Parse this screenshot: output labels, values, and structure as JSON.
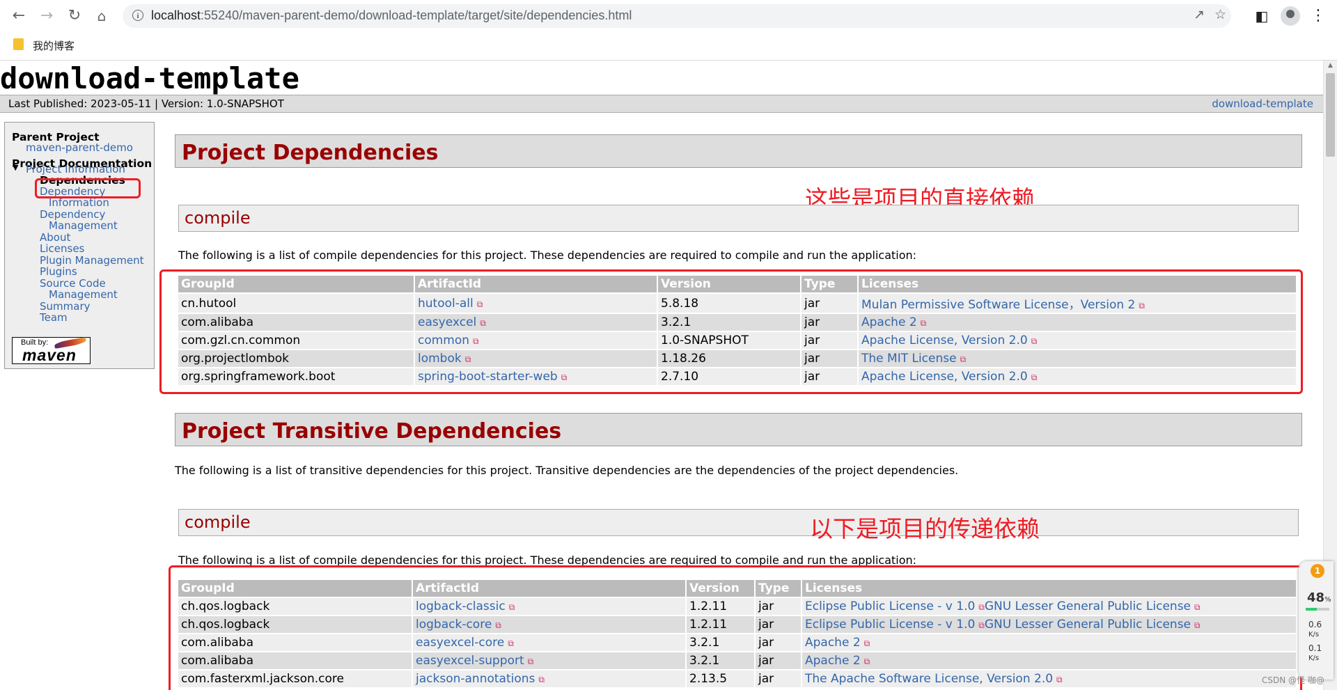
{
  "browser": {
    "back_icon": "arrow-left",
    "forward_icon": "arrow-right",
    "reload_icon": "reload",
    "home_icon": "home",
    "url_host": "localhost",
    "url_path": ":55240/maven-parent-demo/download-template/target/site/dependencies.html",
    "share_icon": "share",
    "star_icon": "star",
    "sidepanel_icon": "side-panel",
    "menu_icon": "more-vertical",
    "bookmark_label": "我的博客"
  },
  "site": {
    "title": "download-template",
    "last_published": "Last Published: 2023-05-11  | Version: 1.0-SNAPSHOT",
    "breadcrumb_right": "download-template"
  },
  "sidebar": {
    "parent_heading": "Parent Project",
    "parent_link": "maven-parent-demo",
    "doc_heading": "Project Documentation",
    "project_info": "Project Information",
    "current": "Dependencies",
    "links": [
      "Dependency",
      "Information",
      "Dependency",
      "Management",
      "About",
      "Licenses",
      "Plugin Management",
      "Plugins",
      "Source Code",
      "Management",
      "Summary",
      "Team"
    ],
    "built_by": "Built by:",
    "maven": "maven"
  },
  "main": {
    "h2_direct": "Project Dependencies",
    "h3_compile": "compile",
    "direct_desc": "The following is a list of compile dependencies for this project. These dependencies are required to compile and run the application:",
    "annot_direct": "这些是项目的直接依赖",
    "columns": [
      "GroupId",
      "ArtifactId",
      "Version",
      "Type",
      "Licenses"
    ],
    "direct_rows": [
      {
        "group": "cn.hutool",
        "artifact": "hutool-all",
        "version": "5.8.18",
        "type": "jar",
        "license": "Mulan Permissive Software License，Version 2"
      },
      {
        "group": "com.alibaba",
        "artifact": "easyexcel",
        "version": "3.2.1",
        "type": "jar",
        "license": "Apache 2"
      },
      {
        "group": "com.gzl.cn.common",
        "artifact": "common",
        "version": "1.0-SNAPSHOT",
        "type": "jar",
        "license": "Apache License, Version 2.0"
      },
      {
        "group": "org.projectlombok",
        "artifact": "lombok",
        "version": "1.18.26",
        "type": "jar",
        "license": "The MIT License"
      },
      {
        "group": "org.springframework.boot",
        "artifact": "spring-boot-starter-web",
        "version": "2.7.10",
        "type": "jar",
        "license": "Apache License, Version 2.0"
      }
    ],
    "h2_transitive": "Project Transitive Dependencies",
    "transitive_desc": "The following is a list of transitive dependencies for this project. Transitive dependencies are the dependencies of the project dependencies.",
    "h3_compile2": "compile",
    "annot_transitive": "以下是项目的传递依赖",
    "transitive_compile_desc": "The following is a list of compile dependencies for this project. These dependencies are required to compile and run the application:",
    "transitive_rows": [
      {
        "group": "ch.qos.logback",
        "artifact": "logback-classic",
        "version": "1.2.11",
        "type": "jar",
        "license": "Eclipse Public License - v 1.0",
        "license2": "GNU Lesser General Public License"
      },
      {
        "group": "ch.qos.logback",
        "artifact": "logback-core",
        "version": "1.2.11",
        "type": "jar",
        "license": "Eclipse Public License - v 1.0",
        "license2": "GNU Lesser General Public License"
      },
      {
        "group": "com.alibaba",
        "artifact": "easyexcel-core",
        "version": "3.2.1",
        "type": "jar",
        "license": "Apache 2",
        "license2": ""
      },
      {
        "group": "com.alibaba",
        "artifact": "easyexcel-support",
        "version": "3.2.1",
        "type": "jar",
        "license": "Apache 2",
        "license2": ""
      },
      {
        "group": "com.fasterxml.jackson.core",
        "artifact": "jackson-annotations",
        "version": "2.13.5",
        "type": "jar",
        "license": "The Apache Software License, Version 2.0",
        "license2": ""
      }
    ]
  },
  "widget": {
    "badge": "1",
    "percent": "48",
    "percent_sign": "%",
    "cpu_fraction": 0.48,
    "speed1": "0.6",
    "unit1": "K/s",
    "speed2": "0.1",
    "unit2": "K/s"
  },
  "watermark": "CSDN @怪 咖@",
  "colors": {
    "link": "#3366aa",
    "heading": "#990000",
    "annotation": "#ee1c24",
    "table_header": "#bbbbbb"
  }
}
